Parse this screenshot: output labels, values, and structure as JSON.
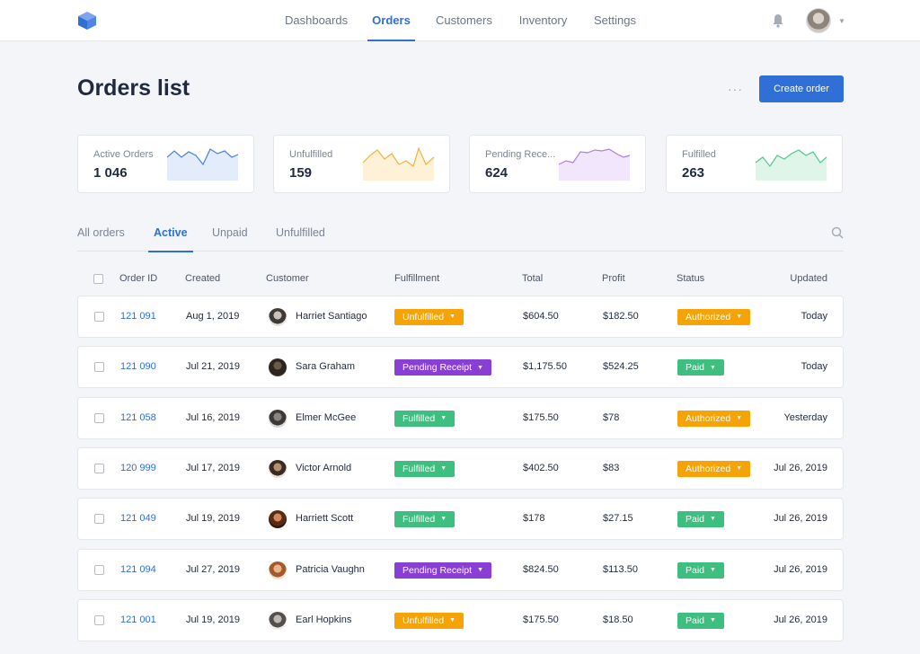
{
  "colors": {
    "accent": "#2f6fd6",
    "orange": "#f5a306",
    "purple": "#8a3fd4",
    "green": "#3fbf7f"
  },
  "nav": {
    "items": [
      {
        "label": "Dashboards"
      },
      {
        "label": "Orders"
      },
      {
        "label": "Customers"
      },
      {
        "label": "Inventory"
      },
      {
        "label": "Settings"
      }
    ],
    "active": "Orders",
    "bell_icon": "bell-icon",
    "logo_icon": "cube-logo-icon"
  },
  "header": {
    "title": "Orders list",
    "more": "···",
    "create_label": "Create order"
  },
  "stats": [
    {
      "label": "Active Orders",
      "value": "1 046",
      "color": "#4a7fe0"
    },
    {
      "label": "Unfulfilled",
      "value": "159",
      "color": "#f2b33d"
    },
    {
      "label": "Pending Rece...",
      "value": "624",
      "color": "#b27ee0"
    },
    {
      "label": "Fulfilled",
      "value": "263",
      "color": "#52c98a"
    }
  ],
  "filters": {
    "tabs": [
      "All orders",
      "Active",
      "Unpaid",
      "Unfulfilled"
    ],
    "active": "Active",
    "search_icon": "search-icon"
  },
  "table": {
    "columns": [
      "Order ID",
      "Created",
      "Customer",
      "Fulfillment",
      "Total",
      "Profit",
      "Status",
      "Updated"
    ],
    "rows": [
      {
        "id": "121 091",
        "created": "Aug 1, 2019",
        "customer": "Harriet Santiago",
        "fulfillment": "Unfulfilled",
        "total": "$604.50",
        "profit": "$182.50",
        "status": "Authorized",
        "updated": "Today"
      },
      {
        "id": "121 090",
        "created": "Jul 21, 2019",
        "customer": "Sara Graham",
        "fulfillment": "Pending Receipt",
        "total": "$1,175.50",
        "profit": "$524.25",
        "status": "Paid",
        "updated": "Today"
      },
      {
        "id": "121 058",
        "created": "Jul 16, 2019",
        "customer": "Elmer McGee",
        "fulfillment": "Fulfilled",
        "total": "$175.50",
        "profit": "$78",
        "status": "Authorized",
        "updated": "Yesterday"
      },
      {
        "id": "120 999",
        "created": "Jul 17, 2019",
        "customer": "Victor Arnold",
        "fulfillment": "Fulfilled",
        "total": "$402.50",
        "profit": "$83",
        "status": "Authorized",
        "updated": "Jul 26, 2019"
      },
      {
        "id": "121 049",
        "created": "Jul 19, 2019",
        "customer": "Harriett Scott",
        "fulfillment": "Fulfilled",
        "total": "$178",
        "profit": "$27.15",
        "status": "Paid",
        "updated": "Jul 26, 2019"
      },
      {
        "id": "121 094",
        "created": "Jul 27, 2019",
        "customer": "Patricia Vaughn",
        "fulfillment": "Pending Receipt",
        "total": "$824.50",
        "profit": "$113.50",
        "status": "Paid",
        "updated": "Jul 26, 2019"
      },
      {
        "id": "121 001",
        "created": "Jul 19, 2019",
        "customer": "Earl Hopkins",
        "fulfillment": "Unfulfilled",
        "total": "$175.50",
        "profit": "$18.50",
        "status": "Paid",
        "updated": "Jul 26, 2019"
      }
    ]
  }
}
